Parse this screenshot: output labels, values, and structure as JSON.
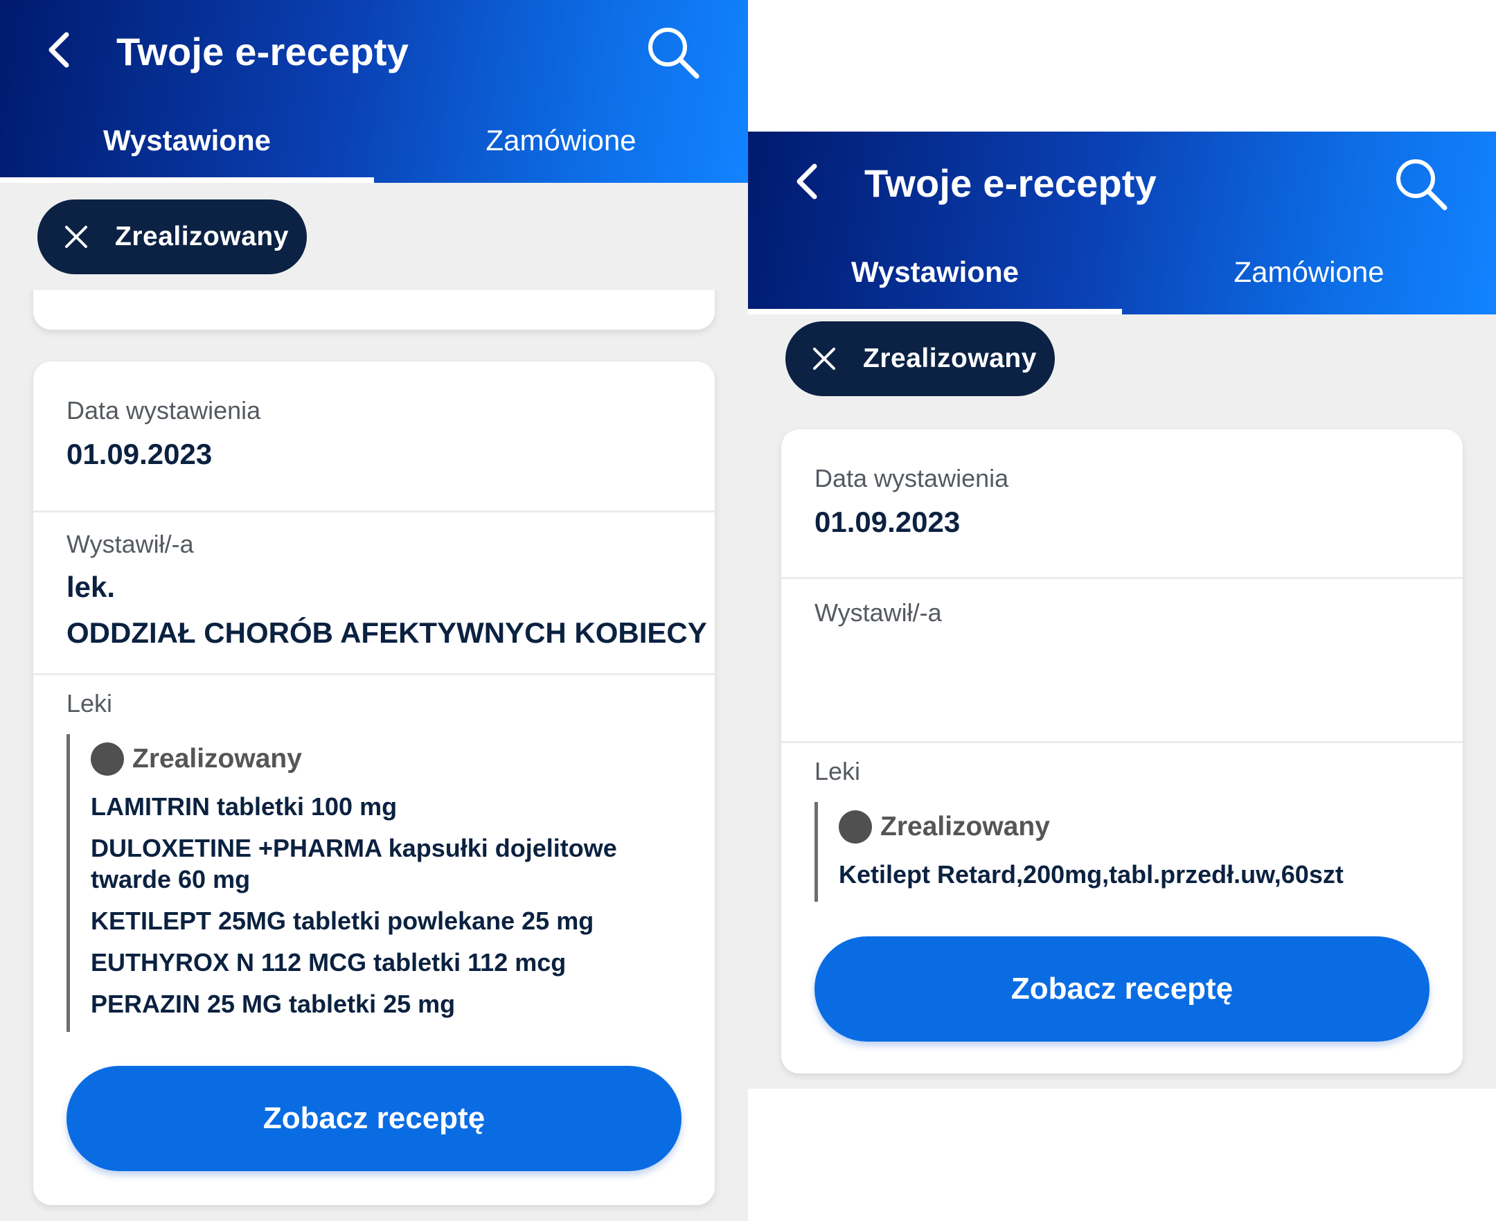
{
  "screens": [
    {
      "appbar": {
        "title": "Twoje e-recepty",
        "tabs": [
          {
            "label": "Wystawione"
          },
          {
            "label": "Zamówione"
          }
        ]
      },
      "filter": {
        "label": "Zrealizowany"
      },
      "card": {
        "date_label": "Data wystawienia",
        "date_value": "01.09.2023",
        "issuer_label": "Wystawił/-a",
        "issuer_lines": [
          "lek.",
          "ODDZIAŁ CHORÓB AFEKTYWNYCH KOBIECY"
        ],
        "meds_label": "Leki",
        "status": "Zrealizowany",
        "meds": [
          "LAMITRIN tabletki 100 mg",
          "DULOXETINE +PHARMA kapsułki dojelitowe twarde 60 mg",
          "KETILEPT 25MG tabletki powlekane 25 mg",
          "EUTHYROX N 112 MCG tabletki 112 mcg",
          "PERAZIN 25 MG tabletki 25 mg"
        ],
        "button_label": "Zobacz receptę"
      }
    },
    {
      "appbar": {
        "title": "Twoje e-recepty",
        "tabs": [
          {
            "label": "Wystawione"
          },
          {
            "label": "Zamówione"
          }
        ]
      },
      "filter": {
        "label": "Zrealizowany"
      },
      "card": {
        "date_label": "Data wystawienia",
        "date_value": "01.09.2023",
        "issuer_label": "Wystawił/-a",
        "meds_label": "Leki",
        "status": "Zrealizowany",
        "meds": [
          "Ketilept Retard,200mg,tabl.przedł.uw,60szt"
        ],
        "button_label": "Zobacz receptę"
      }
    }
  ]
}
